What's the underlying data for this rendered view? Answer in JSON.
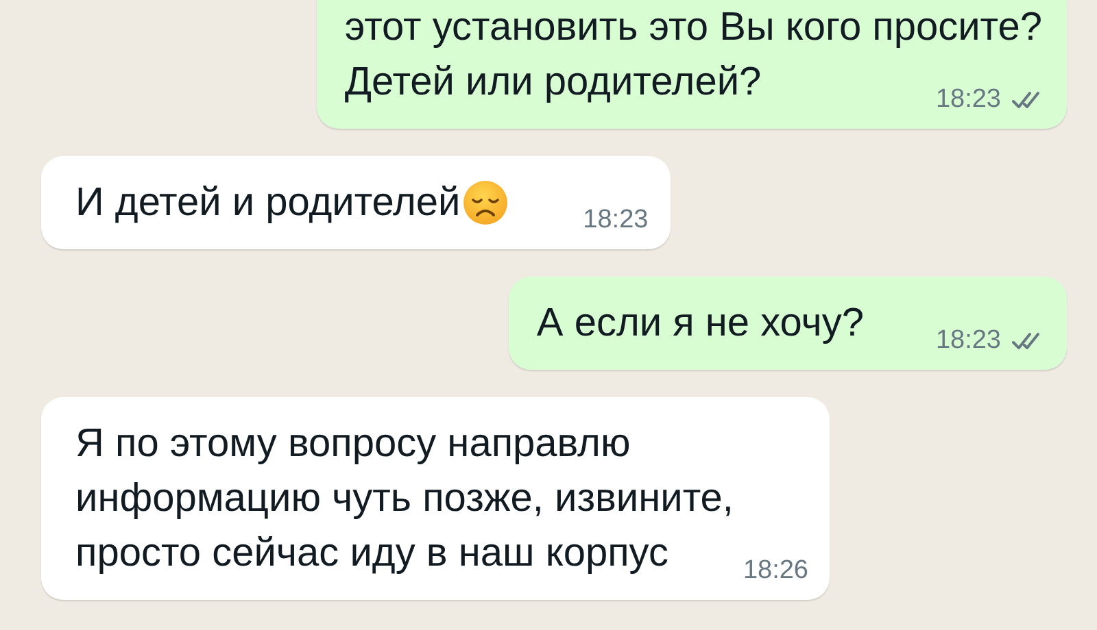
{
  "messages": [
    {
      "kind": "sent",
      "lines": [
        "этот установить это Вы кого просите?",
        "Детей или родителей?"
      ],
      "time": "18:23",
      "read": false
    },
    {
      "kind": "received",
      "lines": [
        "И детей и родителей"
      ],
      "emoji": true,
      "time": "18:23"
    },
    {
      "kind": "sent",
      "lines": [
        "А если я не хочу?"
      ],
      "time": "18:23",
      "read": false
    },
    {
      "kind": "received",
      "lines": [
        "Я по этому вопросу направлю",
        "информацию чуть позже, извините,",
        "просто сейчас иду в наш корпус"
      ],
      "time": "18:26"
    }
  ]
}
